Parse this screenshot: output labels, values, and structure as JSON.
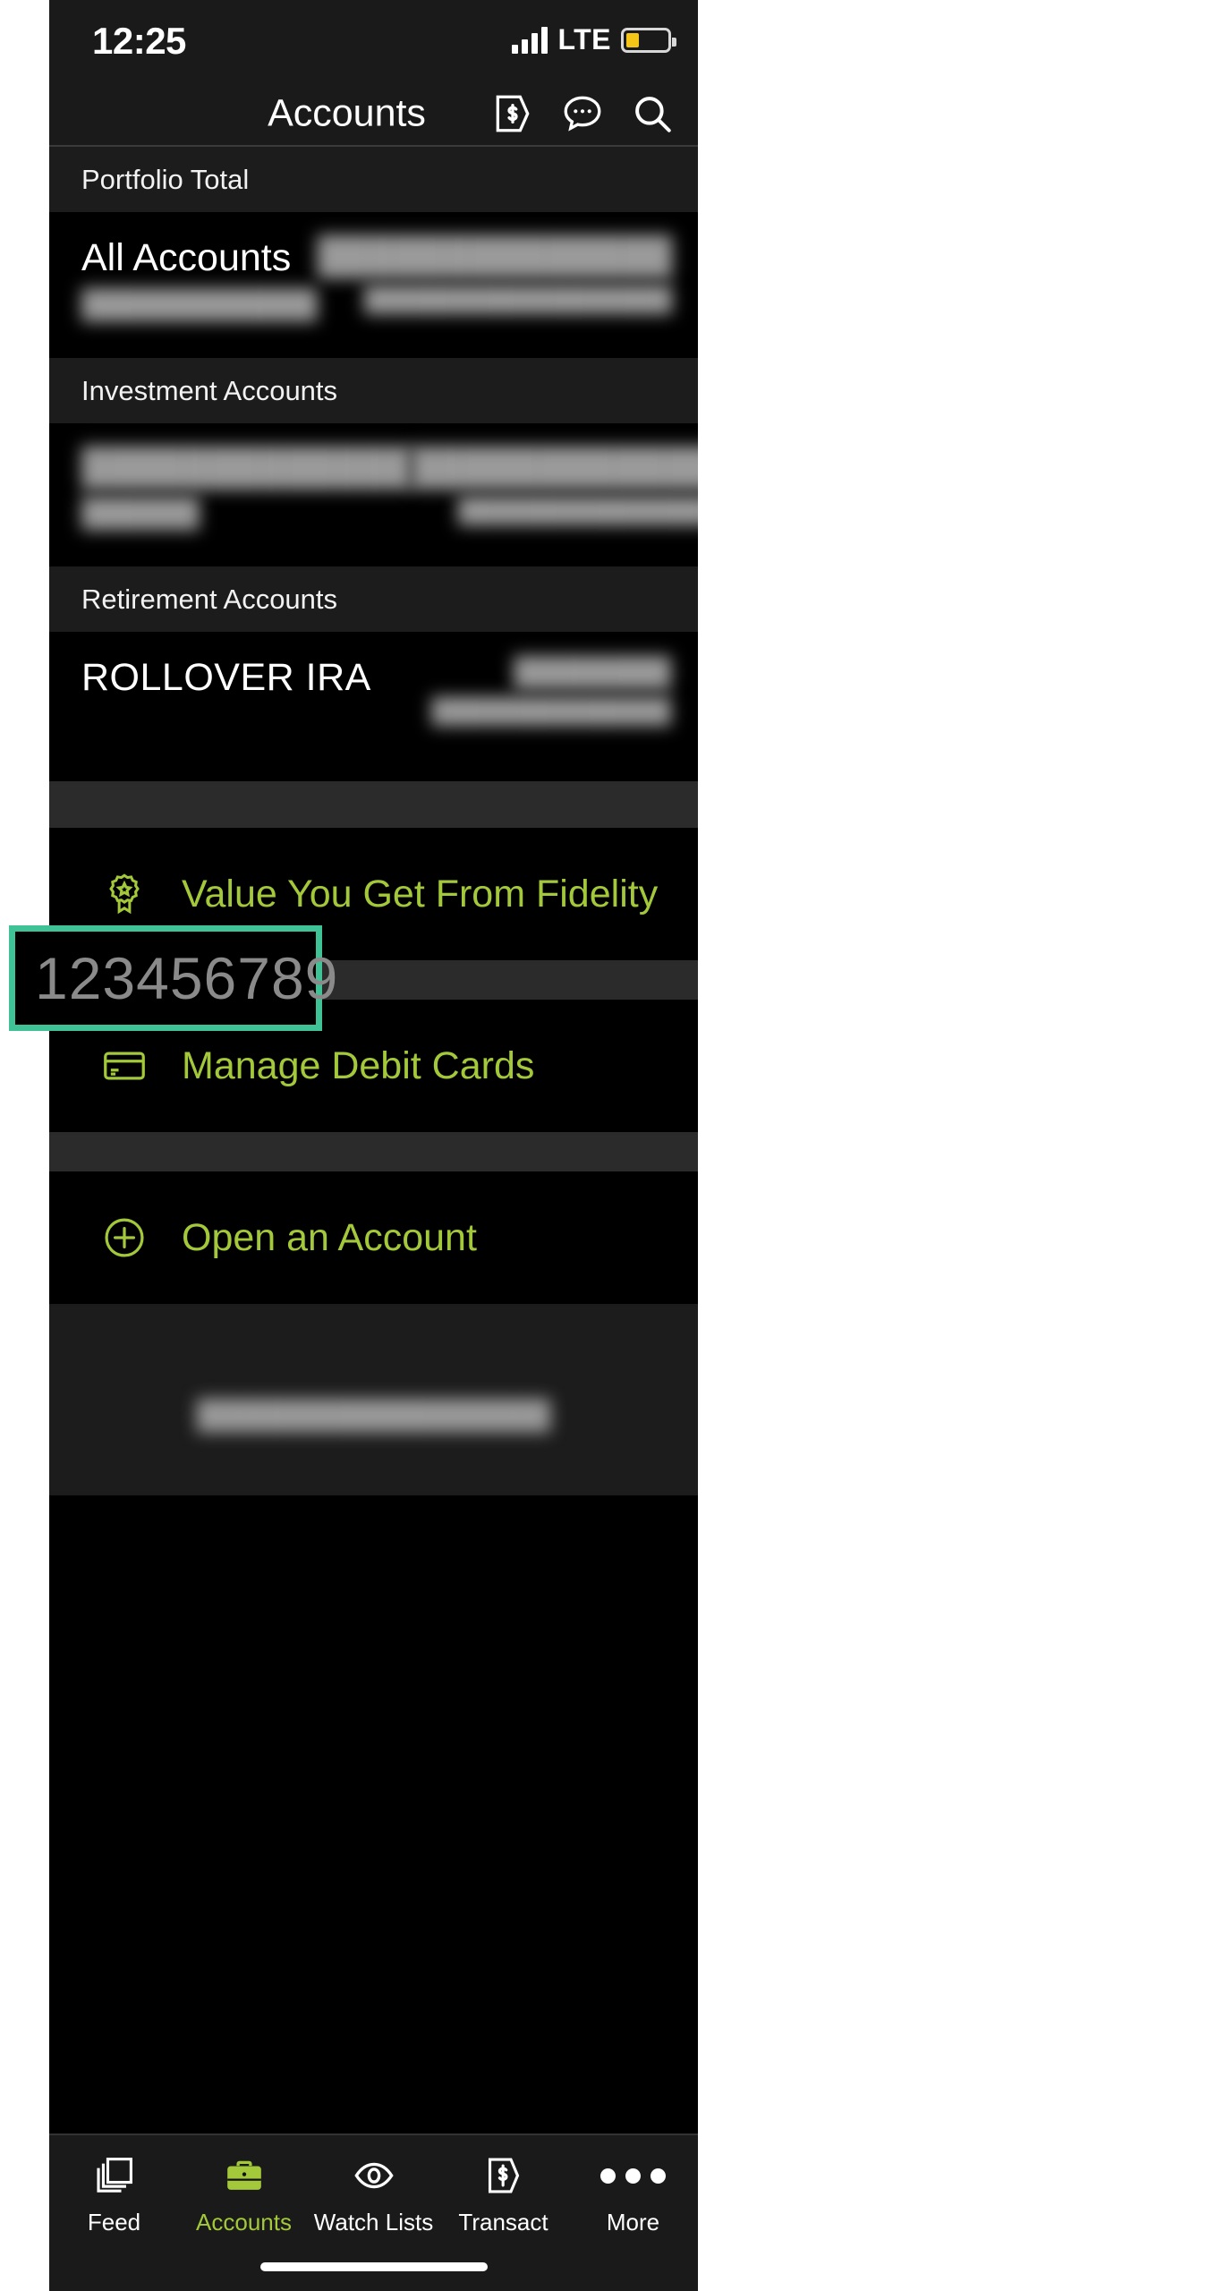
{
  "status_bar": {
    "time": "12:25",
    "network": "LTE",
    "signal_icon": "signal-bars-icon",
    "battery_icon": "battery-icon",
    "battery_level_pct": 32
  },
  "nav_bar": {
    "title": "Accounts",
    "actions": [
      {
        "name": "dollar-tag-icon",
        "label": "Transact"
      },
      {
        "name": "chat-bubble-icon",
        "label": "Messages"
      },
      {
        "name": "search-icon",
        "label": "Search"
      }
    ]
  },
  "sections": [
    {
      "header": "Portfolio Total",
      "rows": [
        {
          "name": "All Accounts",
          "name_style": "normal",
          "name_redacted": false,
          "subtitle_redacted": "████████████",
          "value_redacted": "██████████████",
          "change_redacted": "██████████████████"
        }
      ]
    },
    {
      "header": "Investment Accounts",
      "rows": [
        {
          "name_redacted": "█████████████",
          "subtitle_redacted": "██████",
          "value_redacted": "██████████████",
          "change_redacted": "██████████████████"
        }
      ]
    },
    {
      "header": "Retirement Accounts",
      "rows": [
        {
          "name": "ROLLOVER IRA",
          "name_style": "caps",
          "name_redacted": false,
          "value_redacted": "████████",
          "change_redacted": "██████████████"
        }
      ]
    }
  ],
  "highlight": {
    "account_number": "123456789",
    "border_color": "#3fc396",
    "text_color": "#8a8a8a"
  },
  "menu_rows": [
    {
      "icon": "award-ribbon-icon",
      "label": "Value You Get From Fidelity"
    },
    {
      "icon": "credit-card-icon",
      "label": "Manage Debit Cards"
    },
    {
      "icon": "plus-circle-icon",
      "label": "Open an Account"
    }
  ],
  "footer": {
    "redacted_text": "██████████████████"
  },
  "tab_bar": {
    "active": "Accounts",
    "tabs": [
      {
        "icon": "stacked-cards-icon",
        "label": "Feed",
        "active": false
      },
      {
        "icon": "briefcase-icon",
        "label": "Accounts",
        "active": true
      },
      {
        "icon": "eye-icon",
        "label": "Watch Lists",
        "active": false
      },
      {
        "icon": "dollar-tag-icon",
        "label": "Transact",
        "active": false
      },
      {
        "icon": "ellipsis-icon",
        "label": "More",
        "active": false
      }
    ]
  },
  "colors": {
    "accent_green": "#a3c93a",
    "highlight_green": "#3fc396",
    "screen_bg": "#000000",
    "chrome_bg": "#1a1a1a"
  }
}
